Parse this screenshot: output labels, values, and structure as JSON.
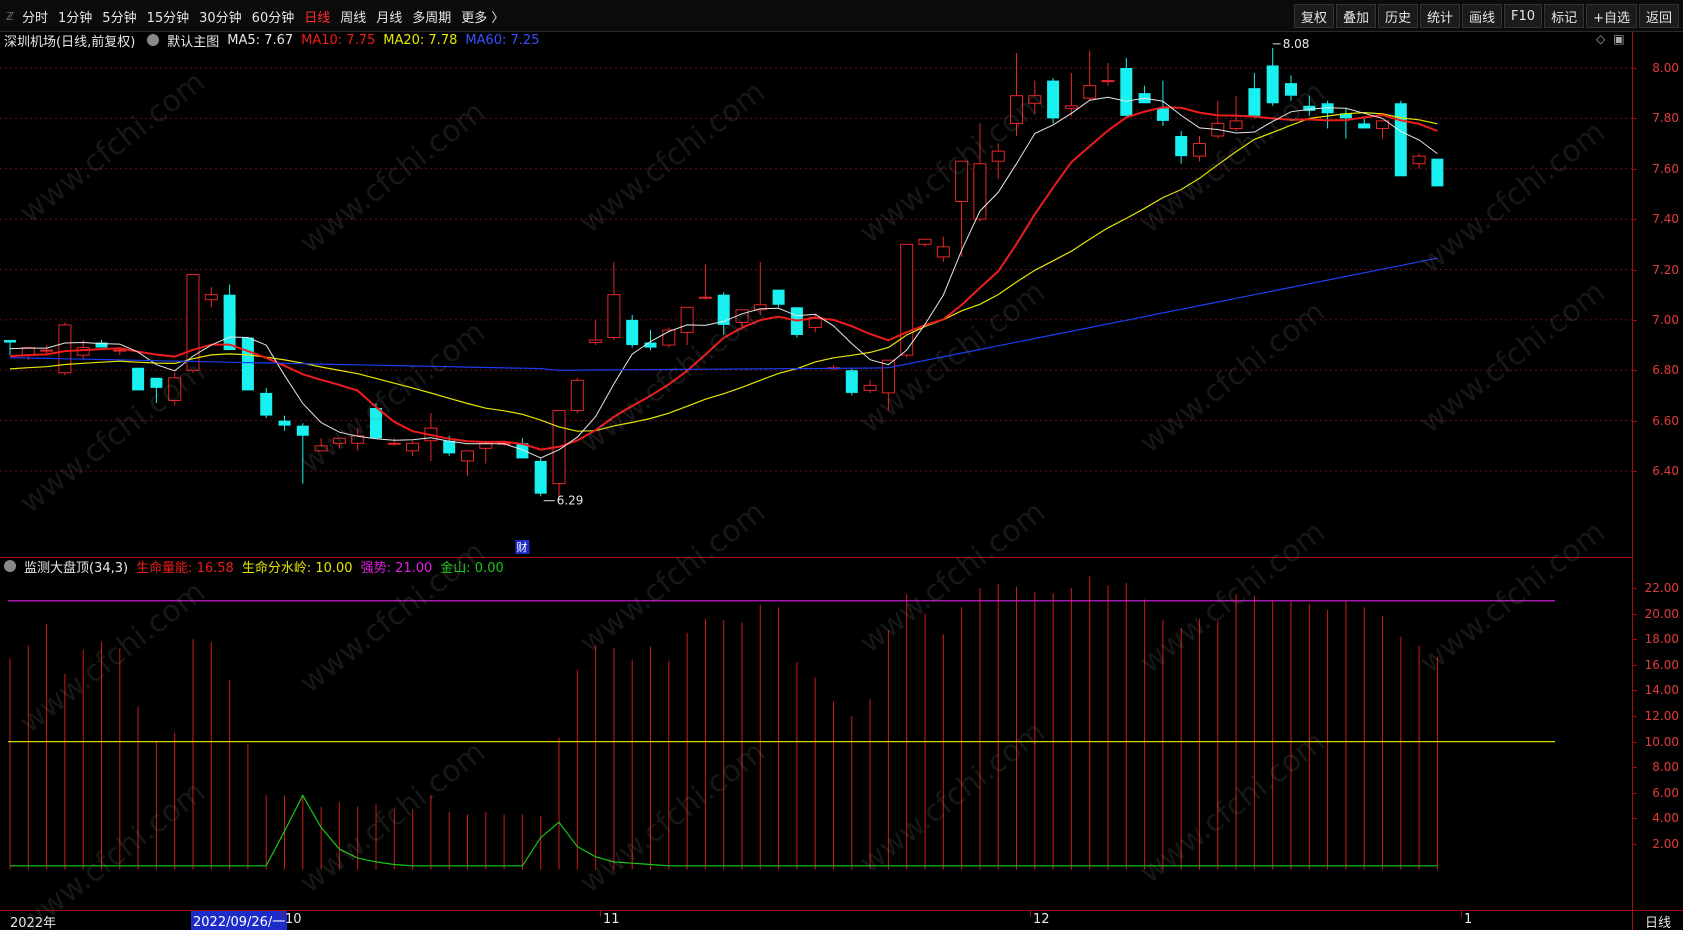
{
  "toolbar": {
    "corner_icon": "collapse-icon",
    "timeframes": [
      {
        "label": "分时",
        "active": false
      },
      {
        "label": "1分钟",
        "active": false
      },
      {
        "label": "5分钟",
        "active": false
      },
      {
        "label": "15分钟",
        "active": false
      },
      {
        "label": "30分钟",
        "active": false
      },
      {
        "label": "60分钟",
        "active": false
      },
      {
        "label": "日线",
        "active": true
      },
      {
        "label": "周线",
        "active": false
      },
      {
        "label": "月线",
        "active": false
      },
      {
        "label": "多周期",
        "active": false
      },
      {
        "label": "更多 〉",
        "active": false
      }
    ],
    "tools": [
      "复权",
      "叠加",
      "历史",
      "统计",
      "画线",
      "F10",
      "标记",
      "+自选",
      "返回"
    ]
  },
  "main_info": {
    "stock": "深圳机场(日线,前复权)",
    "template": "默认主图",
    "ma5": "MA5: 7.67",
    "ma10": "MA10: 7.75",
    "ma20": "MA20: 7.78",
    "ma60": "MA60: 7.25"
  },
  "colors": {
    "up": "#e8262a",
    "down": "#19f0f0",
    "ma5": "#e8e8e8",
    "ma10": "#ee1c1c",
    "ma20": "#e6e600",
    "ma60": "#1e3cf0",
    "grid": "#6a1010",
    "magenta": "#e020e0",
    "yellow": "#d8d800",
    "green": "#18c818"
  },
  "price_axis": [
    "8.00",
    "7.80",
    "7.60",
    "7.40",
    "7.20",
    "7.00",
    "6.80",
    "6.60",
    "6.40"
  ],
  "annotations": {
    "high": "8.08",
    "low": "6.29",
    "finance_tag": "财"
  },
  "indicator": {
    "title": "监测大盘顶(34,3)",
    "life_energy": "生命量能: 16.58",
    "watershed": "生命分水岭: 10.00",
    "strong": "强势: 21.00",
    "jinshan": "金山: 0.00",
    "axis": [
      "22.00",
      "20.00",
      "18.00",
      "16.00",
      "14.00",
      "12.00",
      "10.00",
      "8.00",
      "6.00",
      "4.00",
      "2.00"
    ]
  },
  "dates": {
    "year": "2022年",
    "cursor": "2022/09/26/一",
    "months": [
      "10",
      "11",
      "12",
      "1"
    ],
    "period": "日线"
  },
  "watermark": "www.cfchi.com",
  "chart_data": {
    "type": "candlestick",
    "ylim": [
      6.25,
      8.12
    ],
    "candles": [
      [
        6.92,
        6.92,
        6.86,
        6.91
      ],
      [
        6.86,
        6.89,
        6.84,
        6.89
      ],
      [
        6.88,
        6.9,
        6.86,
        6.88
      ],
      [
        6.79,
        6.99,
        6.78,
        6.98
      ],
      [
        6.86,
        6.92,
        6.84,
        6.89
      ],
      [
        6.91,
        6.92,
        6.89,
        6.89
      ],
      [
        6.88,
        6.89,
        6.86,
        6.88
      ],
      [
        6.81,
        6.81,
        6.72,
        6.72
      ],
      [
        6.77,
        6.77,
        6.67,
        6.73
      ],
      [
        6.68,
        6.79,
        6.66,
        6.77
      ],
      [
        6.8,
        7.18,
        6.79,
        7.18
      ],
      [
        7.08,
        7.13,
        7.05,
        7.1
      ],
      [
        7.1,
        7.14,
        6.89,
        6.88
      ],
      [
        6.93,
        6.93,
        6.76,
        6.72
      ],
      [
        6.71,
        6.73,
        6.61,
        6.62
      ],
      [
        6.6,
        6.62,
        6.56,
        6.58
      ],
      [
        6.58,
        6.59,
        6.35,
        6.54
      ],
      [
        6.48,
        6.53,
        6.48,
        6.5
      ],
      [
        6.51,
        6.53,
        6.49,
        6.53
      ],
      [
        6.51,
        6.57,
        6.48,
        6.54
      ],
      [
        6.65,
        6.67,
        6.53,
        6.53
      ],
      [
        6.51,
        6.53,
        6.5,
        6.51
      ],
      [
        6.48,
        6.52,
        6.46,
        6.51
      ],
      [
        6.52,
        6.63,
        6.44,
        6.57
      ],
      [
        6.52,
        6.54,
        6.46,
        6.47
      ],
      [
        6.44,
        6.48,
        6.38,
        6.48
      ],
      [
        6.49,
        6.52,
        6.43,
        6.51
      ],
      [
        6.51,
        6.52,
        6.5,
        6.51
      ],
      [
        6.51,
        6.53,
        6.45,
        6.45
      ],
      [
        6.44,
        6.45,
        6.3,
        6.31
      ],
      [
        6.35,
        6.61,
        6.29,
        6.64
      ],
      [
        6.64,
        6.77,
        6.63,
        6.76
      ],
      [
        6.91,
        7.0,
        6.9,
        6.92
      ],
      [
        6.93,
        7.23,
        6.92,
        7.1
      ],
      [
        7.0,
        7.02,
        6.89,
        6.9
      ],
      [
        6.91,
        6.96,
        6.88,
        6.89
      ],
      [
        6.9,
        6.97,
        6.89,
        6.96
      ],
      [
        6.95,
        7.05,
        6.9,
        7.05
      ],
      [
        7.09,
        7.22,
        7.08,
        7.09
      ],
      [
        7.1,
        7.11,
        6.94,
        6.98
      ],
      [
        6.99,
        7.04,
        6.96,
        7.04
      ],
      [
        7.04,
        7.23,
        7.02,
        7.06
      ],
      [
        7.12,
        7.12,
        7.05,
        7.06
      ],
      [
        7.05,
        7.05,
        6.93,
        6.94
      ],
      [
        6.97,
        7.02,
        6.95,
        7.01
      ],
      [
        6.81,
        6.82,
        6.8,
        6.81
      ],
      [
        6.8,
        6.81,
        6.7,
        6.71
      ],
      [
        6.72,
        6.76,
        6.71,
        6.74
      ],
      [
        6.71,
        6.84,
        6.64,
        6.84
      ],
      [
        6.86,
        7.3,
        6.85,
        7.3
      ],
      [
        7.3,
        7.32,
        7.29,
        7.32
      ],
      [
        7.25,
        7.33,
        7.23,
        7.29
      ],
      [
        7.47,
        7.55,
        7.25,
        7.63
      ],
      [
        7.4,
        7.78,
        7.39,
        7.62
      ],
      [
        7.63,
        7.7,
        7.56,
        7.67
      ],
      [
        7.78,
        8.06,
        7.73,
        7.89
      ],
      [
        7.86,
        7.95,
        7.82,
        7.89
      ],
      [
        7.95,
        7.96,
        7.78,
        7.8
      ],
      [
        7.84,
        7.98,
        7.81,
        7.85
      ],
      [
        7.88,
        8.07,
        7.87,
        7.93
      ],
      [
        7.95,
        8.02,
        7.93,
        7.95
      ],
      [
        8.0,
        8.04,
        7.8,
        7.81
      ],
      [
        7.9,
        7.93,
        7.86,
        7.86
      ],
      [
        7.84,
        7.95,
        7.77,
        7.79
      ],
      [
        7.73,
        7.75,
        7.62,
        7.65
      ],
      [
        7.65,
        7.73,
        7.63,
        7.7
      ],
      [
        7.73,
        7.87,
        7.72,
        7.78
      ],
      [
        7.76,
        7.89,
        7.75,
        7.79
      ],
      [
        7.92,
        7.98,
        7.8,
        7.81
      ],
      [
        8.01,
        8.08,
        7.85,
        7.86
      ],
      [
        7.94,
        7.97,
        7.87,
        7.89
      ],
      [
        7.85,
        7.89,
        7.81,
        7.83
      ],
      [
        7.86,
        7.87,
        7.76,
        7.82
      ],
      [
        7.82,
        7.84,
        7.72,
        7.8
      ],
      [
        7.78,
        7.8,
        7.77,
        7.76
      ],
      [
        7.76,
        7.79,
        7.72,
        7.79
      ],
      [
        7.86,
        7.87,
        7.66,
        7.57
      ],
      [
        7.62,
        7.66,
        7.6,
        7.65
      ],
      [
        7.64,
        7.64,
        7.53,
        7.53
      ]
    ],
    "ind_values": [
      16.5,
      17.5,
      19.2,
      15.3,
      17.2,
      17.8,
      17.3,
      12.7,
      10.0,
      10.7,
      18.0,
      17.8,
      14.8,
      9.8,
      5.8,
      5.8,
      5.8,
      4.9,
      5.3,
      4.9,
      5.1,
      4.7,
      4.7,
      5.8,
      4.5,
      4.3,
      4.5,
      4.3,
      4.3,
      4.2,
      10.3,
      15.6,
      17.5,
      17.3,
      16.4,
      17.4,
      16.3,
      18.5,
      19.6,
      19.5,
      19.3,
      20.7,
      20.5,
      16.2,
      15.0,
      13.1,
      12.0,
      13.3,
      18.7,
      21.5,
      20.0,
      18.4,
      20.5,
      22.0,
      22.3,
      22.1,
      21.7,
      21.6,
      22.0,
      22.9,
      22.2,
      22.4,
      21.1,
      19.5,
      18.9,
      19.6,
      19.4,
      21.5,
      21.4,
      21.0,
      21.0,
      20.8,
      20.3,
      21.0,
      20.5,
      19.8,
      18.2,
      17.5,
      16.6
    ],
    "ind_green": [
      0.3,
      0.3,
      0.3,
      0.3,
      0.3,
      0.3,
      0.3,
      0.3,
      0.3,
      0.3,
      0.3,
      0.3,
      0.3,
      0.3,
      0.3,
      3.0,
      5.8,
      3.3,
      1.6,
      0.9,
      0.6,
      0.4,
      0.3,
      0.3,
      0.3,
      0.3,
      0.3,
      0.3,
      0.3,
      2.5,
      3.7,
      1.8,
      1.0,
      0.6,
      0.5,
      0.4,
      0.3,
      0.3,
      0.3,
      0.3,
      0.3,
      0.3,
      0.3,
      0.3,
      0.3,
      0.3,
      0.3,
      0.3,
      0.3,
      0.3,
      0.3,
      0.3,
      0.3,
      0.3,
      0.3,
      0.3,
      0.3,
      0.3,
      0.3,
      0.3,
      0.3,
      0.3,
      0.3,
      0.3,
      0.3,
      0.3,
      0.3,
      0.3,
      0.3,
      0.3,
      0.3,
      0.3,
      0.3,
      0.3,
      0.3,
      0.3,
      0.3,
      0.3,
      0.3
    ],
    "ind_ylim": [
      0,
      23.2
    ],
    "watershed_level": 10.0,
    "strong_level": 21.0
  }
}
